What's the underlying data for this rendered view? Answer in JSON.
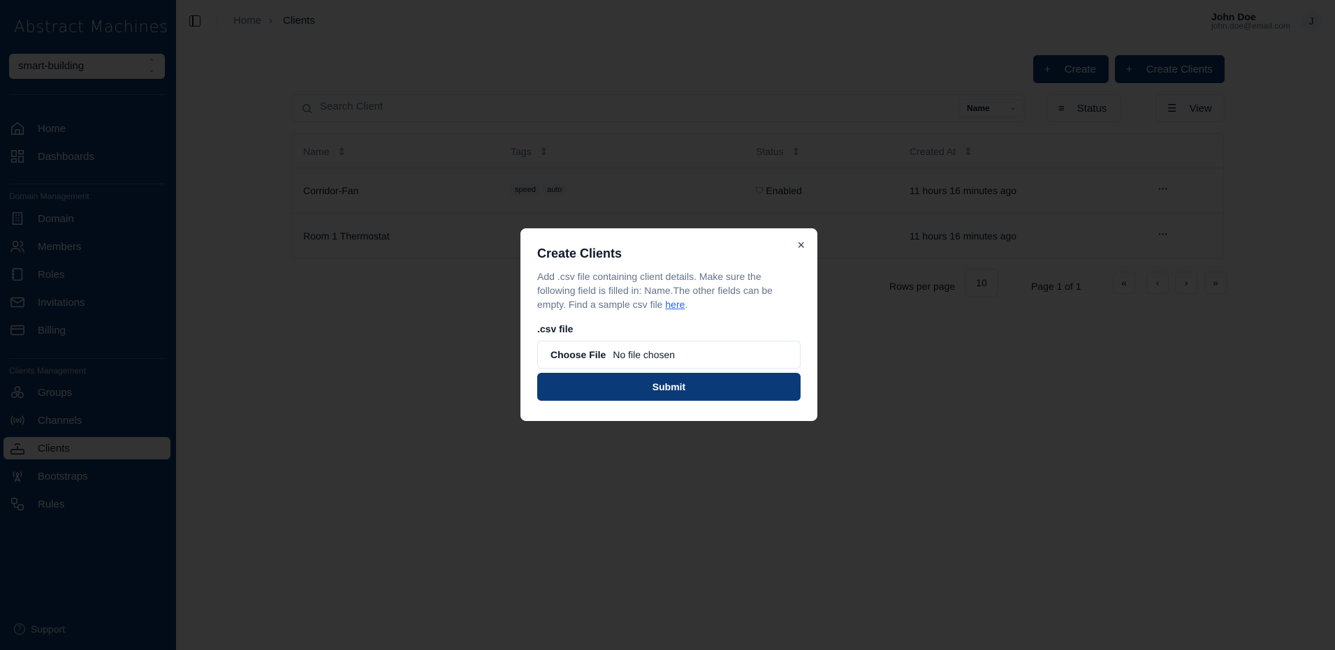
{
  "sidebar": {
    "logo": "Abstract Machines",
    "domain_selector": "smart-building",
    "items_top": [
      {
        "label": "Home",
        "icon": "home-icon"
      },
      {
        "label": "Dashboards",
        "icon": "dashboard-icon"
      }
    ],
    "domain_section": "Domain Management",
    "domain_items": [
      {
        "label": "Domain"
      },
      {
        "label": "Members"
      },
      {
        "label": "Roles"
      },
      {
        "label": "Invitations"
      },
      {
        "label": "Billing"
      }
    ],
    "clients_section": "Clients Management",
    "clients_items": [
      {
        "label": "Groups"
      },
      {
        "label": "Channels"
      },
      {
        "label": "Clients",
        "active": true
      },
      {
        "label": "Bootstraps"
      },
      {
        "label": "Rules"
      }
    ],
    "support": "Support"
  },
  "header": {
    "breadcrumb": [
      "Home",
      "Clients"
    ],
    "user_name": "John Doe",
    "user_email": "john.doe@email.com",
    "avatar": "J"
  },
  "toolbar": {
    "create": "Create",
    "create_clients": "Create Clients",
    "search_placeholder": "Search Client",
    "search_field": "Name",
    "status": "Status",
    "view": "View"
  },
  "table": {
    "columns": [
      "Name",
      "Tags",
      "Status",
      "Created At"
    ],
    "rows": [
      {
        "name": "Corridor-Fan",
        "tags": [
          "speed",
          "auto"
        ],
        "status": "Enabled",
        "created": "11 hours 16 minutes ago",
        "actions": "···"
      },
      {
        "name": "Room 1 Thermostat",
        "tags": [],
        "status": "",
        "created": "11 hours 16 minutes ago",
        "actions": "···"
      }
    ]
  },
  "pagination": {
    "rows_per_page_label": "Rows per page",
    "rows_per_page": "10",
    "page": "Page 1 of 1",
    "first": "«",
    "prev": "‹",
    "next": "›",
    "last": "»"
  },
  "modal": {
    "title": "Create Clients",
    "desc": "Add .csv file containing client details. Make sure the following field is filled in: Name.The other fields can be empty. Find a sample csv file ",
    "link": "here",
    "desc_end": ".",
    "field_label": ".csv file",
    "choose_file": "Choose File",
    "no_file": "No file chosen",
    "submit": "Submit",
    "close": "×"
  },
  "colors": {
    "sidebar": "#0b3b7a",
    "primary": "#0a3a78",
    "overlay": "rgba(0,0,0,0.8)"
  }
}
